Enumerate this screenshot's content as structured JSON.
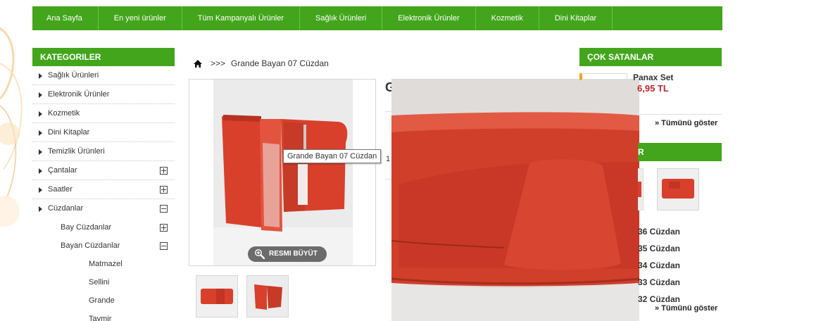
{
  "nav": {
    "items": [
      {
        "label": "Ana Sayfa"
      },
      {
        "label": "En yeni ürünler"
      },
      {
        "label": "Tüm Kampanyalı Ürünler"
      },
      {
        "label": "Sağlık Ürünleri"
      },
      {
        "label": "Elektronik Ürünler"
      },
      {
        "label": "Kozmetik"
      },
      {
        "label": "Dini Kitaplar"
      }
    ]
  },
  "categories": {
    "title": "KATEGORILER",
    "items": [
      {
        "label": "Sağlık Ürünleri"
      },
      {
        "label": "Elektronik Ürünler"
      },
      {
        "label": "Kozmetik"
      },
      {
        "label": "Dini Kitaplar"
      },
      {
        "label": "Temizlik Ürünleri"
      },
      {
        "label": "Çantalar"
      },
      {
        "label": "Saatler"
      },
      {
        "label": "Cüzdanlar"
      }
    ],
    "sub": [
      {
        "label": "Bay Cüzdanlar"
      },
      {
        "label": "Bayan Cüzdanlar"
      }
    ],
    "subsub": [
      {
        "label": "Matmazel"
      },
      {
        "label": "Sellini"
      },
      {
        "label": "Grande"
      },
      {
        "label": "Taymir"
      }
    ]
  },
  "breadcrumb": {
    "separator": ">>>",
    "current": "Grande Bayan 07 Cüzdan"
  },
  "product": {
    "zoom_label": "RESMI BÜYÜT",
    "tooltip": "Grande Bayan 07 Cüzdan",
    "info_title_fragment": "G",
    "info_num_fragment": "1"
  },
  "bestsellers": {
    "title": "ÇOK SATANLAR",
    "item_name": "Panax Set",
    "item_price": "6,95 TL",
    "show_all": "» Tümünü göster"
  },
  "related": {
    "title_fragment": "R",
    "items": [
      {
        "label": "36 Cüzdan"
      },
      {
        "label": "35 Cüzdan"
      },
      {
        "label": "34 Cüzdan"
      },
      {
        "label": "33 Cüzdan"
      },
      {
        "label": "32 Cüzdan"
      }
    ],
    "show_all": "» Tümünü göster"
  },
  "colors": {
    "brand_green": "#43a51c",
    "price_red": "#c0272d",
    "wallet_red": "#d8402c"
  },
  "icons": {
    "home": "home-icon",
    "zoom": "magnifier-plus-icon",
    "arrow": "triangle-right-icon",
    "expand": "plus-box-icon",
    "collapse": "minus-box-icon"
  }
}
